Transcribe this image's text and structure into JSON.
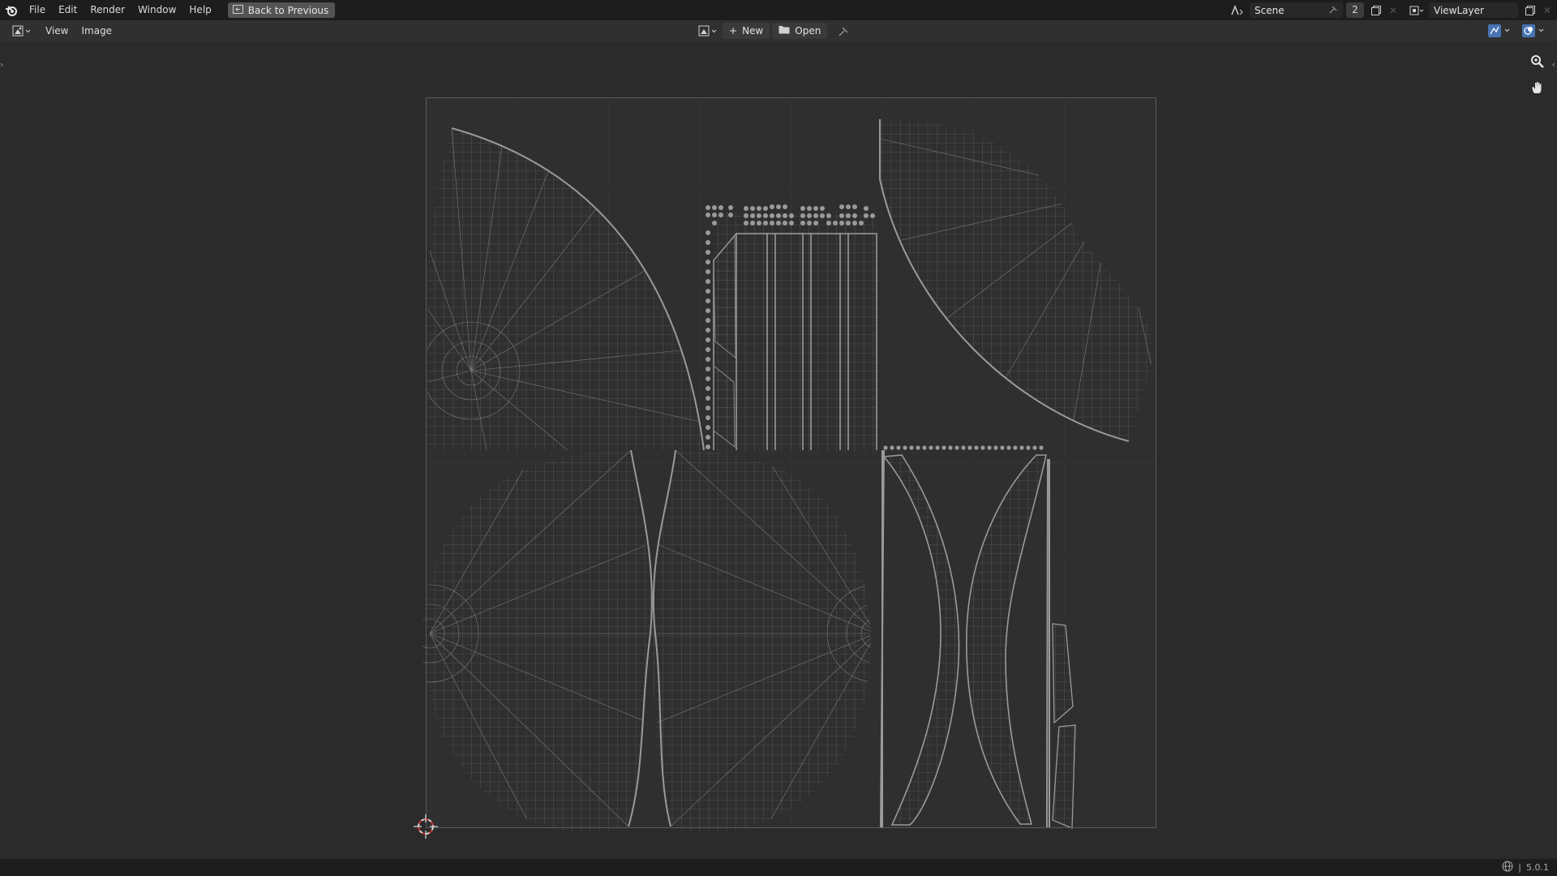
{
  "topbar": {
    "menus": [
      "File",
      "Edit",
      "Render",
      "Window",
      "Help"
    ],
    "back_label": "Back to Previous",
    "scene_name": "Scene",
    "scene_users": "2",
    "view_layer": "ViewLayer"
  },
  "header": {
    "menus": [
      "View",
      "Image"
    ],
    "new_label": "New",
    "open_label": "Open"
  },
  "status": {
    "version": "5.0.1"
  },
  "colors": {
    "background": "#2b2b2b",
    "topbar": "#1d1d1d",
    "uv_wire": "#8a8a8a",
    "uv_bounds": "#6e6e6e"
  },
  "icons": [
    "blender-logo-icon",
    "back-icon",
    "scene-icon",
    "pin-icon",
    "duplicate-icon",
    "close-icon",
    "view-layer-icon",
    "editor-type-icon",
    "image-browse-icon",
    "plus-icon",
    "folder-icon",
    "uv-sync-icon",
    "overlay-icon",
    "zoom-icon",
    "hand-pan-icon",
    "cursor-2d-icon",
    "globe-icon"
  ]
}
